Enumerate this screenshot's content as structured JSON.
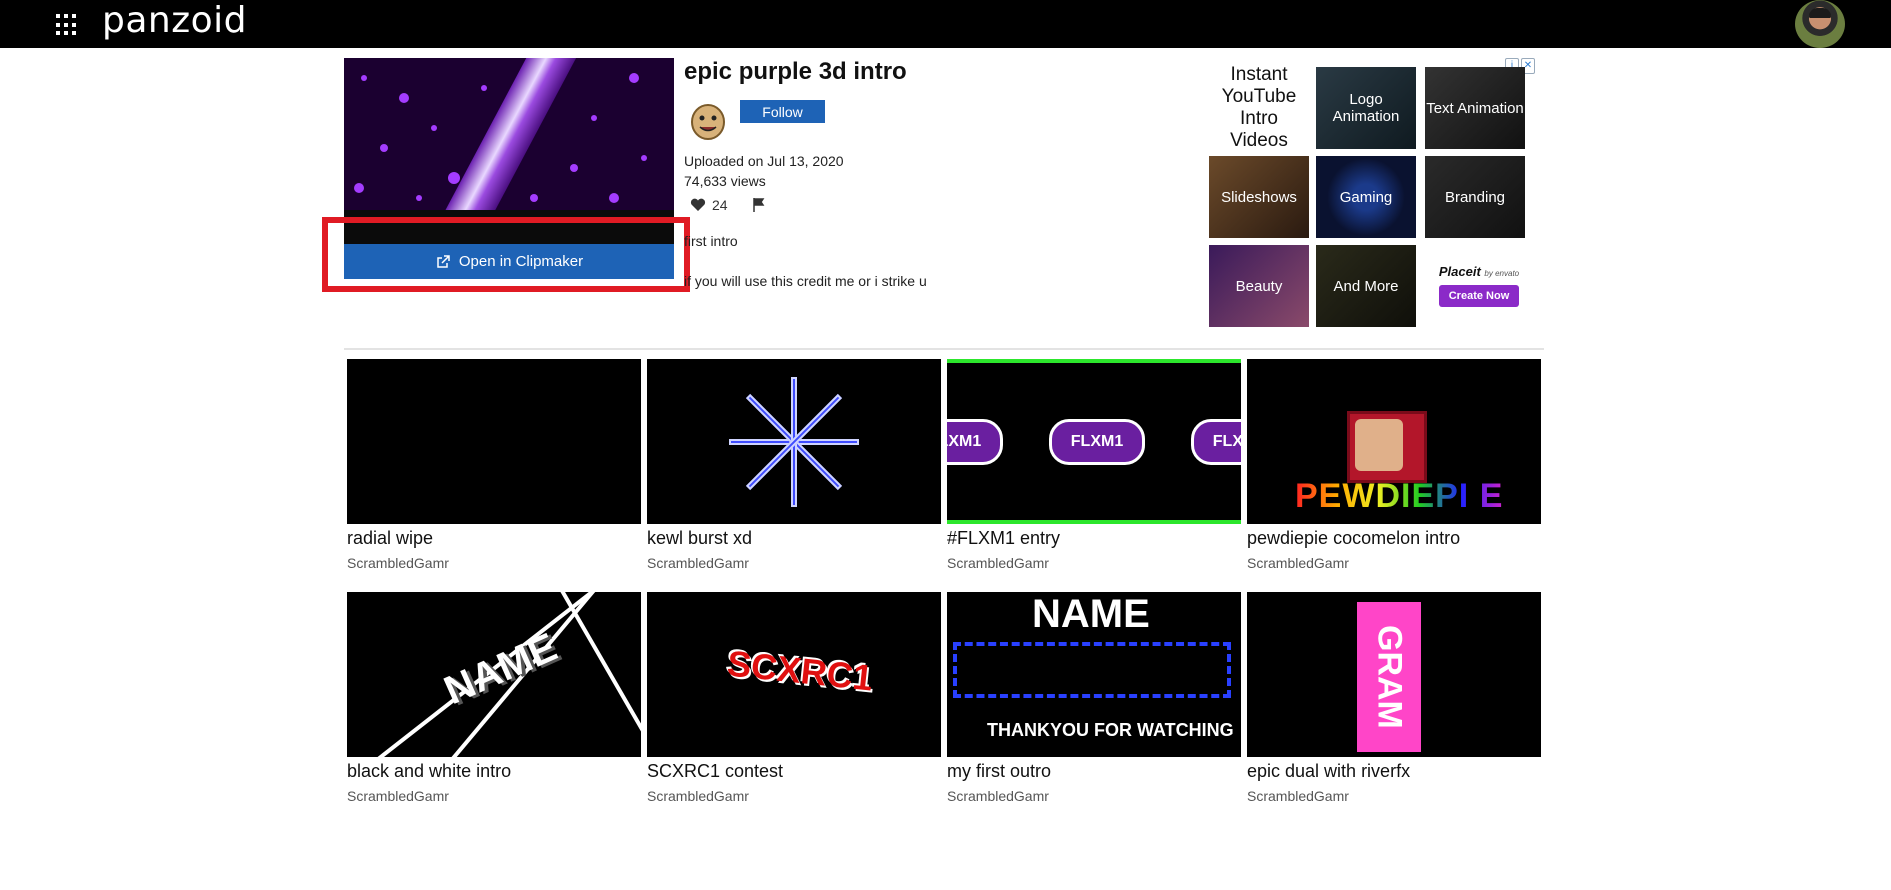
{
  "header": {
    "brand": "panzoid",
    "apps_icon": "grid-apps-icon",
    "avatar_icon": "user-avatar"
  },
  "video": {
    "title": "epic purple 3d intro",
    "open_label": "Open in Clipmaker",
    "follow_label": "Follow",
    "uploaded": "Uploaded on Jul 13, 2020",
    "views": "74,633 views",
    "likes": "24",
    "description_lines": [
      "first intro",
      "if you will use this credit me or i strike u"
    ]
  },
  "ads": {
    "tiles": [
      {
        "label": "Instant YouTube Intro Videos"
      },
      {
        "label": "Logo Animation"
      },
      {
        "label": "Text Animation"
      },
      {
        "label": "Slideshows"
      },
      {
        "label": "Gaming"
      },
      {
        "label": "Branding"
      },
      {
        "label": "Beauty"
      },
      {
        "label": "And More"
      }
    ],
    "placeit": {
      "logo": "Placeit",
      "by": "by envato",
      "cta": "Create Now"
    }
  },
  "related": [
    {
      "title": "radial wipe",
      "user": "ScrambledGamr"
    },
    {
      "title": "kewl burst xd",
      "user": "ScrambledGamr"
    },
    {
      "title": "#FLXM1 entry",
      "user": "ScrambledGamr"
    },
    {
      "title": "pewdiepie cocomelon intro",
      "user": "ScrambledGamr"
    },
    {
      "title": "black and white intro",
      "user": "ScrambledGamr"
    },
    {
      "title": "SCXRC1 contest",
      "user": "ScrambledGamr"
    },
    {
      "title": "my first outro",
      "user": "ScrambledGamr"
    },
    {
      "title": "epic dual with riverfx",
      "user": "ScrambledGamr"
    }
  ],
  "thumb_text": {
    "flxm": "FLXM1",
    "pew": "PEWDIEPI E",
    "bw": "NAME",
    "scx": "SCXRC1",
    "outro_name": "NAME",
    "outro_thanks": "THANKYOU FOR WATCHING",
    "dual": "GRAM"
  },
  "colors": {
    "accent_blue": "#1e63b6",
    "highlight_red": "#e01b24",
    "placeit_purple": "#8b2ac8"
  }
}
